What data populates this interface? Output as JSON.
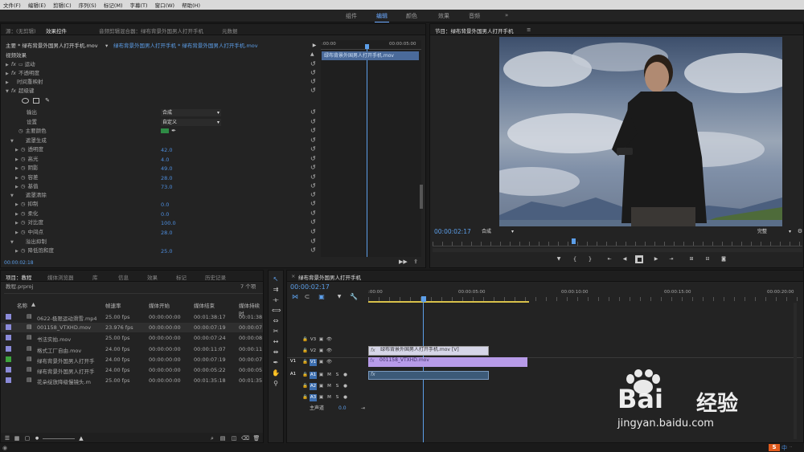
{
  "menu": [
    "文件(F)",
    "编辑(E)",
    "剪辑(C)",
    "序列(S)",
    "标记(M)",
    "字幕(T)",
    "窗口(W)",
    "帮助(H)"
  ],
  "workspaces": [
    "组件",
    "编辑",
    "颜色",
    "效果",
    "音频"
  ],
  "workspace_more": "»",
  "source_tabs": [
    "源：(无剪辑)",
    "效果控件",
    "音频剪辑混合器：绿布背景外国男人打开手机",
    "元数据"
  ],
  "effect_controls": {
    "header": "主要 * 绿布背景外国男人打开手机.mov",
    "header_arrow": "▾",
    "header_seq": "绿布背景外国男人打开手机 * 绿布背景外国男人打开手机.mov",
    "mini_tc_start": ":00:00",
    "mini_tc_end": "00:00:05:00",
    "mini_clip": "绿布背景外国男人打开手机.mov",
    "video_effects": "视频效果",
    "effects": [
      "运动",
      "不透明度",
      "时间重映射",
      "超级键"
    ],
    "fx_label": "fx",
    "output_label": "输出",
    "output_value": "合成",
    "settings_label": "设置",
    "settings_value": "自定义",
    "key_color_label": "主要颜色",
    "matte_gen": "遮罩生成",
    "matte_gen_params": [
      {
        "label": "透明度",
        "value": "42.0"
      },
      {
        "label": "高光",
        "value": "4.0"
      },
      {
        "label": "阴影",
        "value": "49.0"
      },
      {
        "label": "容差",
        "value": "28.0"
      },
      {
        "label": "基值",
        "value": "73.0"
      }
    ],
    "matte_clean": "遮罩清除",
    "matte_clean_params": [
      {
        "label": "抑制",
        "value": "0.0"
      },
      {
        "label": "柔化",
        "value": "0.0"
      },
      {
        "label": "对比度",
        "value": "100.0"
      },
      {
        "label": "中间点",
        "value": "28.0"
      }
    ],
    "spill": "溢出抑制",
    "spill_params": [
      {
        "label": "降低饱和度",
        "value": "25.0"
      }
    ],
    "timecode": "00:00:02:18"
  },
  "program": {
    "title": "节目：绿布背景外国男人打开手机",
    "menu_icon": "≡",
    "timecode": "00:00:02:17",
    "fit": "合成",
    "quality": "完整"
  },
  "project": {
    "tabs": [
      "项目：教程",
      "媒体浏览器",
      "库",
      "信息",
      "效果",
      "标记",
      "历史记录"
    ],
    "name": "教程.prproj",
    "count": "7 个项",
    "columns": [
      "名称",
      "帧速率",
      "媒体开始",
      "媒体结束",
      "媒体持续时"
    ],
    "sort_arrow": "▲",
    "items": [
      {
        "name": "0622-极限运动滑雪.mp4",
        "fps": "25.00 fps",
        "start": "00:00:00:00",
        "end": "00:01:38:17",
        "dur": "00:01:38",
        "color": "#8a8ad8"
      },
      {
        "name": "001158_VTXHD.mov",
        "fps": "23.976 fps",
        "start": "00:00:00:00",
        "end": "00:00:07:19",
        "dur": "00:00:07",
        "color": "#8a8ad8"
      },
      {
        "name": "书法实拍.mov",
        "fps": "25.00 fps",
        "start": "00:00:00:00",
        "end": "00:00:07:24",
        "dur": "00:00:08",
        "color": "#8a8ad8"
      },
      {
        "name": "格式工厂自由.mov",
        "fps": "24.00 fps",
        "start": "00:00:00:00",
        "end": "00:00:11:07",
        "dur": "00:00:11",
        "color": "#8a8ad8"
      },
      {
        "name": "绿布背景外国男人打开手",
        "fps": "24.00 fps",
        "start": "00:00:00:00",
        "end": "00:00:07:19",
        "dur": "00:00:07",
        "color": "#3ea53e"
      },
      {
        "name": "绿布背景外国男人打开手",
        "fps": "24.00 fps",
        "start": "00:00:00:00",
        "end": "00:00:05:22",
        "dur": "00:00:05",
        "color": "#8a8ad8"
      },
      {
        "name": "花朵绽放降级慢镜头.m",
        "fps": "25.00 fps",
        "start": "00:00:00:00",
        "end": "00:01:35:18",
        "dur": "00:01:35",
        "color": "#8a8ad8"
      }
    ]
  },
  "timeline": {
    "title": "绿布背景外国男人打开手机",
    "close": "×",
    "timecode": "00:00:02:17",
    "ruler": [
      ":00:00",
      "00:00:05:00",
      "00:00:10:00",
      "00:00:15:00",
      "00:00:20:00"
    ],
    "video_tracks": [
      "V3",
      "V2",
      "V1"
    ],
    "audio_tracks": [
      "A1",
      "A2",
      "A3"
    ],
    "source_patch_v": "V1",
    "source_patch_a": "A1",
    "master": "主声道",
    "master_value": "0.0",
    "clip_v2": "绿布背景外国男人打开手机.mov [V]",
    "clip_v1": "001158_VTXHD.mov",
    "fx": "fx",
    "mute": "M",
    "solo": "S"
  },
  "watermark": {
    "brand": "Bai",
    "brand2": "经验",
    "url": "jingyan.baidu.com"
  },
  "ime": {
    "logo": "S",
    "text": "中"
  },
  "colors": {
    "accent": "#5c9ee8",
    "panel": "#232323",
    "clip_v1": "#b79be8",
    "clip_v2": "#d6d6e8",
    "audio": "#3c5a78"
  }
}
